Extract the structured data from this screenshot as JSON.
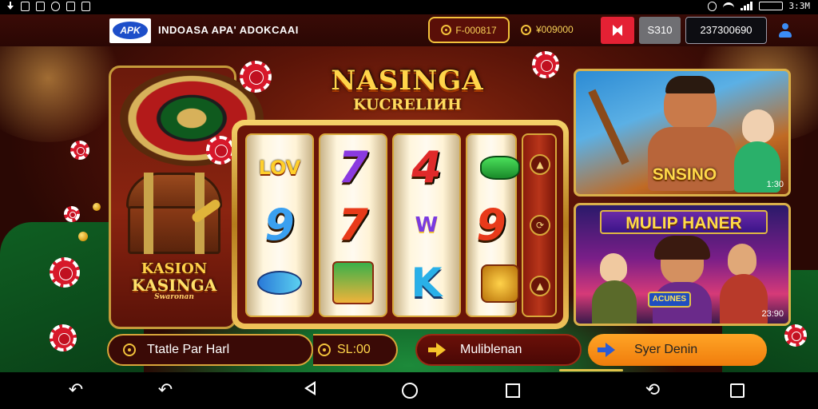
{
  "status_bar": {
    "time": "3:3M",
    "battery": "",
    "left_icons": [
      "download-icon",
      "gallery-icon",
      "notification-icon",
      "shield-icon",
      "box-icon",
      "app-icon"
    ],
    "right_icons": [
      "alarm-icon",
      "wifi-icon",
      "signal-icon",
      "battery-icon"
    ]
  },
  "header": {
    "logo_text": "APK",
    "title": "INDOASA APA' ADOKCAAI",
    "coin_pill": "F-000817",
    "balance": "¥009000",
    "red_button_icon": "flag-icon",
    "gray_button": "SЗ10",
    "user_id": "237300690",
    "accent_color": "#f3c23b",
    "brand_blue": "#1d4ec9"
  },
  "left_panel": {
    "logo_line1": "KASION",
    "logo_line2": "KASINGA",
    "logo_line3": "Swaronan"
  },
  "main_title": {
    "line1": "NASINGA",
    "line2": "KUCRELIИH"
  },
  "slot": {
    "reels": [
      [
        "LOV",
        "7",
        "9"
      ],
      [
        "7",
        "7",
        "K"
      ],
      [
        "4",
        "W",
        "K"
      ],
      [
        "",
        "9",
        ""
      ]
    ],
    "side_buttons": [
      "▲",
      "⟳",
      "▲"
    ]
  },
  "cards": [
    {
      "title": "SNSINO",
      "time": "1:30"
    },
    {
      "title": "MULIP HANER",
      "badge": "ACUNES",
      "time": "23:90"
    }
  ],
  "action_bar": {
    "button1_label": "Ttatle Par Harl",
    "button1_amount": "SL:00",
    "button2_label": "Muliblenan",
    "button3_label": "Syer Denin"
  },
  "nav_bar": {
    "items": [
      "back-alt-icon",
      "back-icon",
      "home-triangle-icon",
      "home-circle-icon",
      "recents-icon",
      "rotate-icon",
      "screenshot-icon"
    ]
  }
}
